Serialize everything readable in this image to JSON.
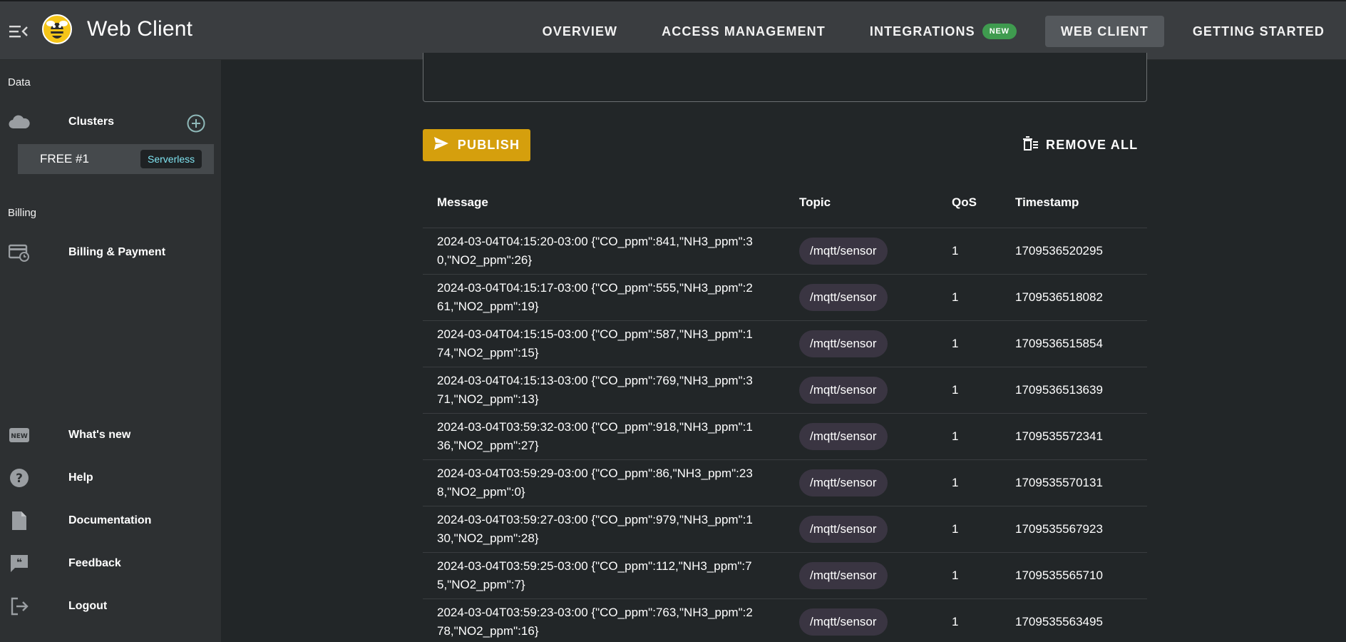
{
  "app": {
    "title": "Web Client"
  },
  "nav": {
    "items": [
      {
        "label": "OVERVIEW"
      },
      {
        "label": "ACCESS MANAGEMENT"
      },
      {
        "label": "INTEGRATIONS",
        "badge": "NEW"
      },
      {
        "label": "WEB CLIENT",
        "active": true
      },
      {
        "label": "GETTING STARTED"
      }
    ]
  },
  "sidebar": {
    "data_label": "Data",
    "clusters_label": "Clusters",
    "cluster": {
      "name": "FREE #1",
      "badge": "Serverless"
    },
    "billing_label": "Billing",
    "billing_item": "Billing & Payment",
    "footer_items": [
      {
        "label": "What's new",
        "icon": "new-icon"
      },
      {
        "label": "Help",
        "icon": "help-icon"
      },
      {
        "label": "Documentation",
        "icon": "document-icon"
      },
      {
        "label": "Feedback",
        "icon": "feedback-icon"
      },
      {
        "label": "Logout",
        "icon": "logout-icon"
      }
    ]
  },
  "actions": {
    "publish": "PUBLISH",
    "remove_all": "REMOVE ALL"
  },
  "table": {
    "headers": {
      "message": "Message",
      "topic": "Topic",
      "qos": "QoS",
      "timestamp": "Timestamp"
    },
    "rows": [
      {
        "message": "2024-03-04T04:15:20-03:00 {\"CO_ppm\":841,\"NH3_ppm\":30,\"NO2_ppm\":26}",
        "topic": "/mqtt/sensor",
        "qos": "1",
        "timestamp": "1709536520295"
      },
      {
        "message": "2024-03-04T04:15:17-03:00 {\"CO_ppm\":555,\"NH3_ppm\":261,\"NO2_ppm\":19}",
        "topic": "/mqtt/sensor",
        "qos": "1",
        "timestamp": "1709536518082"
      },
      {
        "message": "2024-03-04T04:15:15-03:00 {\"CO_ppm\":587,\"NH3_ppm\":174,\"NO2_ppm\":15}",
        "topic": "/mqtt/sensor",
        "qos": "1",
        "timestamp": "1709536515854"
      },
      {
        "message": "2024-03-04T04:15:13-03:00 {\"CO_ppm\":769,\"NH3_ppm\":371,\"NO2_ppm\":13}",
        "topic": "/mqtt/sensor",
        "qos": "1",
        "timestamp": "1709536513639"
      },
      {
        "message": "2024-03-04T03:59:32-03:00 {\"CO_ppm\":918,\"NH3_ppm\":136,\"NO2_ppm\":27}",
        "topic": "/mqtt/sensor",
        "qos": "1",
        "timestamp": "1709535572341"
      },
      {
        "message": "2024-03-04T03:59:29-03:00 {\"CO_ppm\":86,\"NH3_ppm\":238,\"NO2_ppm\":0}",
        "topic": "/mqtt/sensor",
        "qos": "1",
        "timestamp": "1709535570131"
      },
      {
        "message": "2024-03-04T03:59:27-03:00 {\"CO_ppm\":979,\"NH3_ppm\":130,\"NO2_ppm\":28}",
        "topic": "/mqtt/sensor",
        "qos": "1",
        "timestamp": "1709535567923"
      },
      {
        "message": "2024-03-04T03:59:25-03:00 {\"CO_ppm\":112,\"NH3_ppm\":75,\"NO2_ppm\":7}",
        "topic": "/mqtt/sensor",
        "qos": "1",
        "timestamp": "1709535565710"
      },
      {
        "message": "2024-03-04T03:59:23-03:00 {\"CO_ppm\":763,\"NH3_ppm\":278,\"NO2_ppm\":16}",
        "topic": "/mqtt/sensor",
        "qos": "1",
        "timestamp": "1709535563495"
      }
    ]
  },
  "colors": {
    "topbar": "#3a3d40",
    "sidebar": "#2d3032",
    "background": "#222628",
    "publish": "#d59f0d",
    "new_badge": "#3f9b4f",
    "serverless_badge_text": "#7fe3f0"
  }
}
